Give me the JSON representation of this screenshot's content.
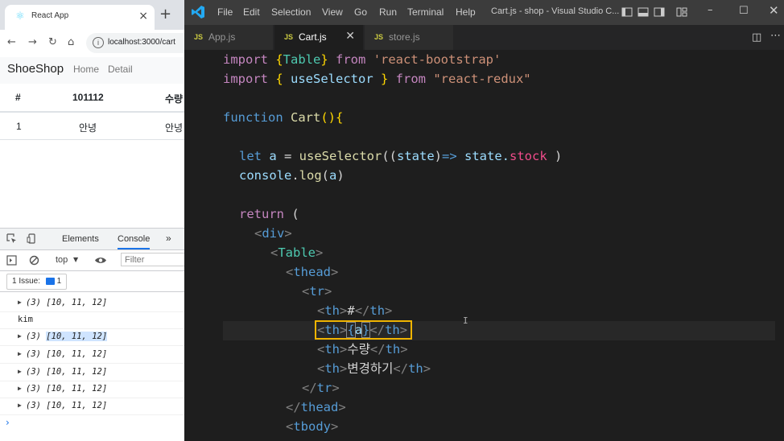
{
  "browser": {
    "tab_title": "React App",
    "url": "localhost:3000/cart",
    "brand": "ShoeShop",
    "nav": [
      "Home",
      "Detail"
    ],
    "table": {
      "headers": [
        "#",
        "101112",
        "수량"
      ],
      "row": [
        "1",
        "안녕",
        "안녕"
      ]
    },
    "devtools": {
      "tabs": [
        "Elements",
        "Console"
      ],
      "more": "»",
      "context": "top",
      "filter_placeholder": "Filter",
      "issues_label": "1 Issue:",
      "issues_count": "1",
      "console_lines": [
        {
          "type": "array",
          "text": "(3) [10, 11, 12]",
          "highlight": false
        },
        {
          "type": "plain",
          "text": "kim"
        },
        {
          "type": "array",
          "text": "(3) [10, 11, 12]",
          "highlight": true
        },
        {
          "type": "array",
          "text": "(3) [10, 11, 12]",
          "highlight": false
        },
        {
          "type": "array",
          "text": "(3) [10, 11, 12]",
          "highlight": false
        },
        {
          "type": "array",
          "text": "(3) [10, 11, 12]",
          "highlight": false
        },
        {
          "type": "array",
          "text": "(3) [10, 11, 12]",
          "highlight": false
        }
      ],
      "prompt": "›"
    }
  },
  "vscode": {
    "menu": [
      "File",
      "Edit",
      "Selection",
      "View",
      "Go",
      "Run",
      "Terminal",
      "Help"
    ],
    "window_title": "Cart.js - shop - Visual Studio C...",
    "tabs": [
      {
        "badge": "JS",
        "name": "App.js",
        "active": false
      },
      {
        "badge": "JS",
        "name": "Cart.js",
        "active": true
      },
      {
        "badge": "JS",
        "name": "store.js",
        "active": false
      }
    ],
    "code": {
      "l1": [
        "import ",
        "{",
        "Table",
        "}",
        " from ",
        "'react-bootstrap'"
      ],
      "l2": [
        "import ",
        "{ ",
        "useSelector",
        " } ",
        "from ",
        "\"react-redux\""
      ],
      "l3": [
        "function ",
        "Cart",
        "(){"
      ],
      "l4": [
        "let ",
        "a",
        " = ",
        "useSelector",
        "((",
        "state",
        ")",
        "=>",
        " state.",
        "stock",
        " )"
      ],
      "l5": [
        "console",
        ".",
        "log",
        "(",
        "a",
        ")"
      ],
      "l6": [
        "return",
        " ("
      ],
      "l7": [
        "<",
        "div",
        ">"
      ],
      "l8": [
        "<",
        "Table",
        ">"
      ],
      "l9": [
        "<",
        "thead",
        ">"
      ],
      "l10": [
        "<",
        "tr",
        ">"
      ],
      "l11": [
        "<",
        "th",
        ">",
        "#",
        "</",
        "th",
        ">"
      ],
      "l12": [
        "<",
        "th",
        ">",
        "{",
        "a",
        "}",
        "</",
        "th",
        ">"
      ],
      "l13": [
        "<",
        "th",
        ">",
        "수량",
        "</",
        "th",
        ">"
      ],
      "l14": [
        "<",
        "th",
        ">",
        "변경하기",
        "</",
        "th",
        ">"
      ],
      "l15": [
        "</",
        "tr",
        ">"
      ],
      "l16": [
        "</",
        "thead",
        ">"
      ],
      "l17": [
        "<",
        "tbody",
        ">"
      ]
    }
  }
}
